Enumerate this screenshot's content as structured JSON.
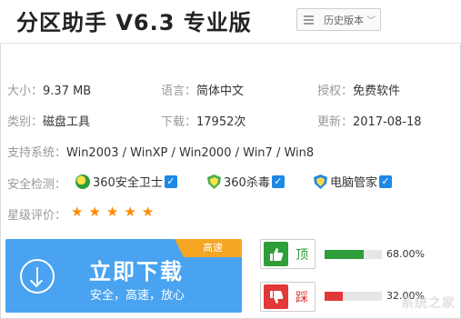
{
  "header": {
    "title": "分区助手 V6.3 专业版",
    "history_label": "历史版本"
  },
  "info": {
    "size_label": "大小：",
    "size_value": "9.37 MB",
    "lang_label": "语言：",
    "lang_value": "简体中文",
    "license_label": "授权：",
    "license_value": "免费软件",
    "category_label": "类别：",
    "category_value": "磁盘工具",
    "downloads_label": "下载：",
    "downloads_value": "17952次",
    "update_label": "更新：",
    "update_value": "2017-08-18",
    "os_label": "支持系统：",
    "os_value": "Win2003 / WinXP / Win2000 / Win7 / Win8"
  },
  "security": {
    "label": "安全检测：",
    "items": [
      {
        "name": "360安全卫士",
        "checked": "✓"
      },
      {
        "name": "360杀毒",
        "checked": "✓"
      },
      {
        "name": "电脑管家",
        "checked": "✓"
      }
    ],
    "colors": {
      "check": "#1e88e5"
    }
  },
  "rating": {
    "label": "星级评价：",
    "stars": 5,
    "star_glyph": "★"
  },
  "download": {
    "title": "立即下载",
    "subtitle": "安全，高速，放心",
    "corner_label": "高速",
    "color": "#4aa3f0"
  },
  "votes": {
    "up_label": "顶",
    "up_percent": "68.00%",
    "up_fraction": 0.68,
    "down_label": "踩",
    "down_percent": "32.00%",
    "down_fraction": 0.32,
    "colors": {
      "up": "#2e9e3b",
      "down": "#e23838"
    }
  },
  "watermark": "系统之家"
}
